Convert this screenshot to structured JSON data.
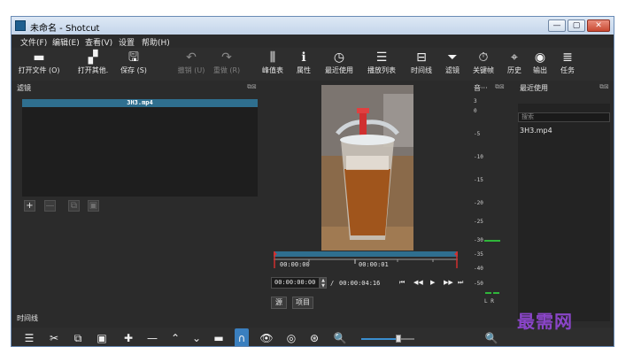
{
  "window": {
    "title": "未命名 - Shotcut",
    "controls": {
      "minimize": "—",
      "maximize": "▢",
      "close": "✕"
    }
  },
  "menu": [
    "文件(F)",
    "编辑(E)",
    "查看(V)",
    "设置",
    "帮助(H)"
  ],
  "toolbar": [
    {
      "label": "打开文件 (O)",
      "icon": "folder-icon",
      "glyph": "▬",
      "disabled": false
    },
    {
      "label": "打开其他.",
      "icon": "open-other-icon",
      "glyph": "▞",
      "disabled": false
    },
    {
      "label": "保存 (S)",
      "icon": "save-icon",
      "glyph": "🖫",
      "disabled": false
    },
    {
      "label": "撤销 (U)",
      "icon": "undo-icon",
      "glyph": "↶",
      "disabled": true
    },
    {
      "label": "重做 (R)",
      "icon": "redo-icon",
      "glyph": "↷",
      "disabled": true
    },
    {
      "label": "峰值表",
      "icon": "peak-meter-icon",
      "glyph": "⫼",
      "disabled": false
    },
    {
      "label": "属性",
      "icon": "properties-icon",
      "glyph": "ℹ",
      "disabled": false
    },
    {
      "label": "最近使用",
      "icon": "recent-icon",
      "glyph": "◷",
      "disabled": false
    },
    {
      "label": "播放列表",
      "icon": "playlist-icon",
      "glyph": "☰",
      "disabled": false
    },
    {
      "label": "时间线",
      "icon": "timeline-icon",
      "glyph": "⊟",
      "disabled": false
    },
    {
      "label": "滤镜",
      "icon": "filter-icon",
      "glyph": "⏷",
      "disabled": false
    },
    {
      "label": "关键帧",
      "icon": "keyframes-icon",
      "glyph": "⏱",
      "disabled": false
    },
    {
      "label": "历史",
      "icon": "history-icon",
      "glyph": "⌖",
      "disabled": false
    },
    {
      "label": "输出",
      "icon": "export-icon",
      "glyph": "◉",
      "disabled": false
    },
    {
      "label": "任务",
      "icon": "jobs-icon",
      "glyph": "≣",
      "disabled": false
    }
  ],
  "filters_panel": {
    "title": "滤镜",
    "filter_item": "3H3.mp4",
    "buttons": [
      "+",
      "—",
      "⧉",
      "▣"
    ]
  },
  "player": {
    "timecode_start": "00:00:00",
    "timecode_mid": "00:00:01",
    "current_time": "00:00:00:00",
    "separator": "/",
    "duration": "00:00:04:16",
    "tabs": [
      "源",
      "项目"
    ],
    "transport": [
      "⏮",
      "◀◀",
      "▶",
      "▶▶",
      "⏭"
    ]
  },
  "meter_panel": {
    "title": "音···",
    "scale": [
      "3",
      "0",
      "-5",
      "-10",
      "-15",
      "-20",
      "-25",
      "-30",
      "-35",
      "-40",
      "-50"
    ],
    "channels": "L R"
  },
  "recent_panel": {
    "title": "最近使用",
    "search_placeholder": "搜索",
    "items": [
      "3H3.mp4"
    ]
  },
  "timeline": {
    "title": "时间线",
    "toolbar_icons": [
      "menu-icon",
      "cut-icon",
      "copy-icon",
      "paste-icon",
      "append-icon",
      "remove-icon",
      "lift-icon",
      "overwrite-icon",
      "split-icon",
      "snap-icon",
      "scrub-icon",
      "ripple-icon",
      "ripple-all-icon",
      "zoom-out-icon",
      "zoom-in-icon"
    ],
    "zoom_level": 0.7
  },
  "watermark": "最需网",
  "colors": {
    "accent": "#2f6f8f",
    "meter_green": "#2fb63a",
    "scrub_red": "#d03030"
  }
}
